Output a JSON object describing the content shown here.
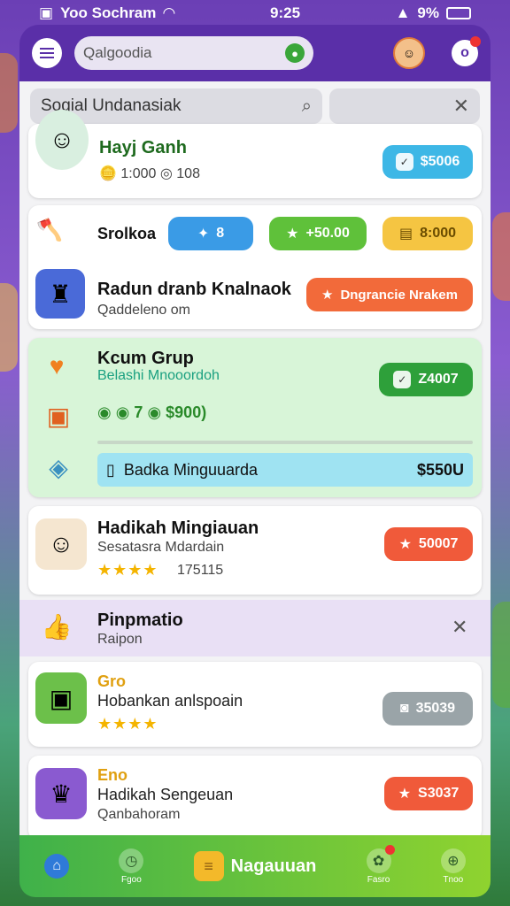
{
  "status": {
    "carrier": "Yoo Sochram",
    "time": "9:25",
    "battery": "9%"
  },
  "header": {
    "search_placeholder": "Qalgoodia"
  },
  "search_bar": {
    "query": "Sogial Undanasiak"
  },
  "user": {
    "name": "Hayj Ganh",
    "stats": "1:000",
    "stats2": "108",
    "button": "$5006"
  },
  "row2": {
    "label": "Srolkoa",
    "pill1": "8",
    "pill2": "+50.00",
    "pill3": "8:000"
  },
  "row3": {
    "title": "Radun dranb Knalnaok",
    "subtitle": "Qaddeleno om",
    "button": "Dngrancie Nrakem"
  },
  "group": {
    "title": "Kcum Grup",
    "subtitle": "Belashi Mnooordoh",
    "button": "Z4007",
    "counts": "7",
    "value": "$900)",
    "bar_label": "Badka Minguuarda",
    "bar_value": "$550U"
  },
  "card4": {
    "title": "Hadikah Mingiauan",
    "subtitle": "Sesatasra Mdardain",
    "rating": "175115",
    "button": "50007"
  },
  "section": {
    "title": "Pinpmatio",
    "subtitle": "Raipon"
  },
  "card5": {
    "tag": "Gro",
    "title": "Hobankan anlspoain",
    "button": "35039"
  },
  "card6": {
    "tag": "Eno",
    "title": "Hadikah Sengeuan",
    "subtitle": "Qanbahoram",
    "button": "S3037"
  },
  "nav": {
    "center_label": "Nagauuan",
    "left_label": "Fgoo",
    "right1_label": "Fasro",
    "right2_label": "Tnoo"
  }
}
